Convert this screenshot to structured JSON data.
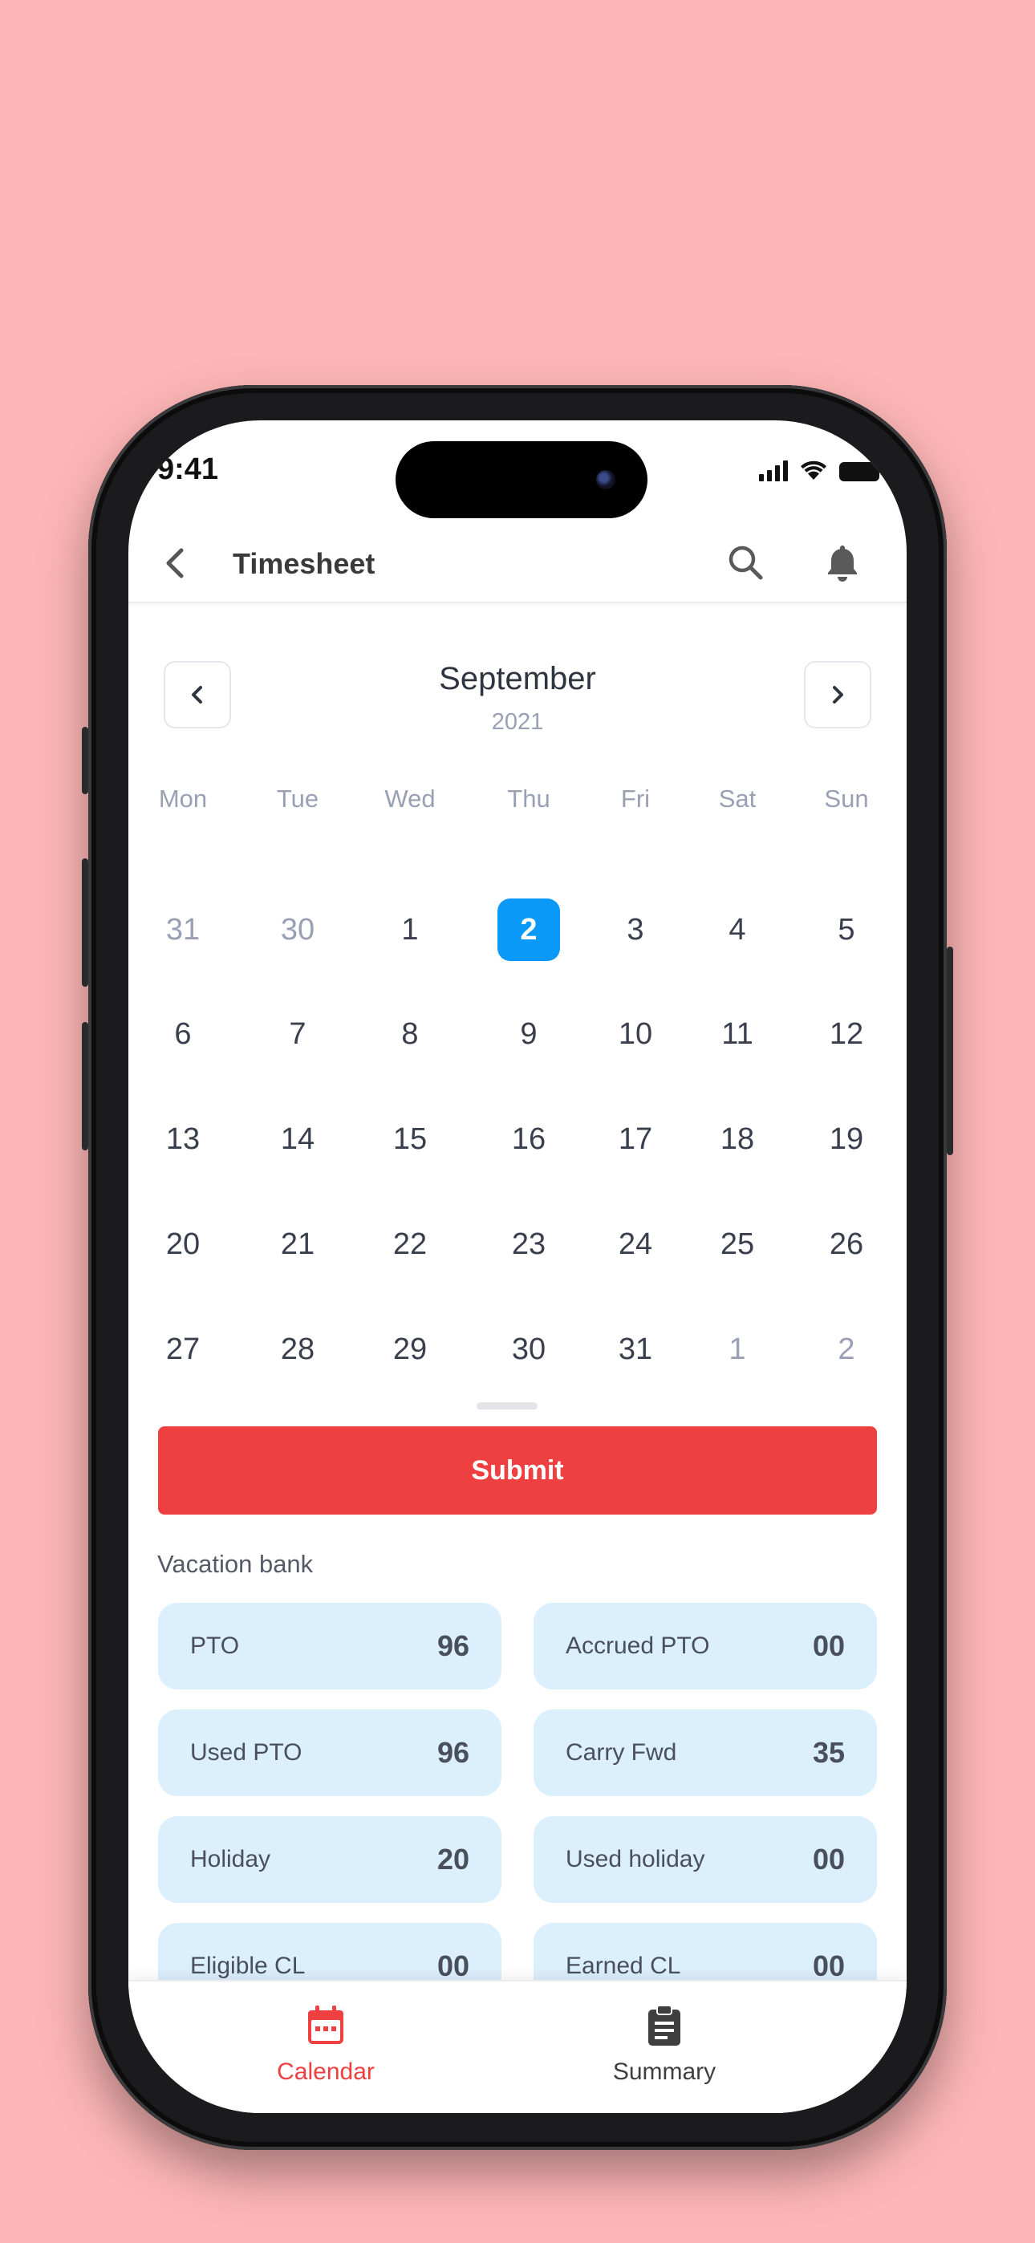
{
  "status_bar": {
    "time": "9:41"
  },
  "header": {
    "title": "Timesheet"
  },
  "calendar": {
    "month": "September",
    "year": "2021",
    "weekdays": [
      "Mon",
      "Tue",
      "Wed",
      "Thu",
      "Fri",
      "Sat",
      "Sun"
    ],
    "weeks": [
      [
        {
          "d": "31",
          "m": true
        },
        {
          "d": "30",
          "m": true
        },
        {
          "d": "1"
        },
        {
          "d": "2",
          "sel": true
        },
        {
          "d": "3"
        },
        {
          "d": "4"
        },
        {
          "d": "5"
        }
      ],
      [
        {
          "d": "6"
        },
        {
          "d": "7"
        },
        {
          "d": "8"
        },
        {
          "d": "9"
        },
        {
          "d": "10"
        },
        {
          "d": "11"
        },
        {
          "d": "12"
        }
      ],
      [
        {
          "d": "13"
        },
        {
          "d": "14"
        },
        {
          "d": "15"
        },
        {
          "d": "16"
        },
        {
          "d": "17"
        },
        {
          "d": "18"
        },
        {
          "d": "19"
        }
      ],
      [
        {
          "d": "20"
        },
        {
          "d": "21"
        },
        {
          "d": "22"
        },
        {
          "d": "23"
        },
        {
          "d": "24"
        },
        {
          "d": "25"
        },
        {
          "d": "26"
        }
      ],
      [
        {
          "d": "27"
        },
        {
          "d": "28"
        },
        {
          "d": "29"
        },
        {
          "d": "30"
        },
        {
          "d": "31"
        },
        {
          "d": "1",
          "m": true
        },
        {
          "d": "2",
          "m": true
        }
      ]
    ]
  },
  "actions": {
    "submit_label": "Submit"
  },
  "vacation_bank": {
    "title": "Vacation bank",
    "items": [
      {
        "label": "PTO",
        "value": "96"
      },
      {
        "label": "Accrued PTO",
        "value": "00"
      },
      {
        "label": "Used PTO",
        "value": "96"
      },
      {
        "label": "Carry Fwd",
        "value": "35"
      },
      {
        "label": "Holiday",
        "value": "20"
      },
      {
        "label": "Used holiday",
        "value": "00"
      },
      {
        "label": "Eligible CL",
        "value": "00"
      },
      {
        "label": "Earned CL",
        "value": "00"
      }
    ]
  },
  "tabs": [
    {
      "label": "Calendar",
      "icon": "calendar-icon",
      "active": true
    },
    {
      "label": "Summary",
      "icon": "clipboard-icon",
      "active": false
    }
  ],
  "colors": {
    "background": "#FDB6B6",
    "accent_red": "#EE4040",
    "selected_blue": "#0A99F8",
    "card_blue": "#DCEFFD",
    "inactive_tab": "#3F3F3F"
  }
}
